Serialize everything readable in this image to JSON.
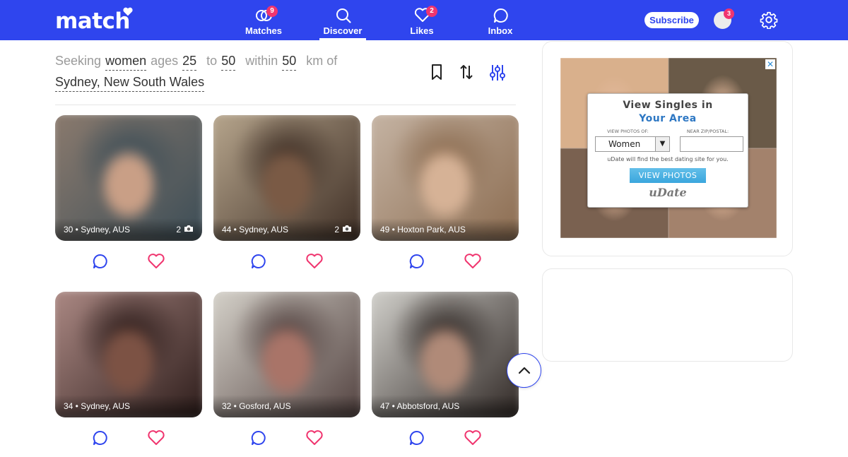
{
  "header": {
    "logo": "match",
    "nav": [
      {
        "label": "Matches",
        "badge": "9"
      },
      {
        "label": "Discover",
        "badge": ""
      },
      {
        "label": "Likes",
        "badge": "2"
      },
      {
        "label": "Inbox",
        "badge": ""
      }
    ],
    "active_nav": "Discover",
    "subscribe": "Subscribe",
    "avatar_badge": "3"
  },
  "filters": {
    "seeking": "Seeking",
    "gender": "women",
    "ages": "ages",
    "age_min": "25",
    "to": "to",
    "age_max": "50",
    "within": "within",
    "distance": "50",
    "unit": "km of",
    "location": "Sydney, New South Wales"
  },
  "profiles": [
    {
      "caption": "30 • Sydney, AUS",
      "photo_count": "2",
      "colors": [
        "#8c7b6e",
        "#3a4c56",
        "#c99f86"
      ]
    },
    {
      "caption": "44 • Sydney, AUS",
      "photo_count": "2",
      "colors": [
        "#b9a88f",
        "#3b2b22",
        "#7a5a45"
      ]
    },
    {
      "caption": "49 • Hoxton Park, AUS",
      "photo_count": "",
      "colors": [
        "#c6b5a5",
        "#8a6a4e",
        "#d6b296"
      ]
    },
    {
      "caption": "34 • Sydney, AUS",
      "photo_count": "",
      "colors": [
        "#ae8b86",
        "#2a1a18",
        "#7c5244"
      ]
    },
    {
      "caption": "32 • Gosford, AUS",
      "photo_count": "",
      "colors": [
        "#d8d5cd",
        "#4f3e3c",
        "#a97468"
      ]
    },
    {
      "caption": "47 • Abbotsford, AUS",
      "photo_count": "",
      "colors": [
        "#d5d4cf",
        "#2b2320",
        "#b08a78"
      ]
    }
  ],
  "ad": {
    "title_line1": "View Singles in",
    "title_line2": "Your Area",
    "label_photos": "VIEW PHOTOS OF:",
    "label_zip": "NEAR ZIP/POSTAL:",
    "select_value": "Women",
    "tagline": "uDate will find the best dating site for you.",
    "button": "VIEW PHOTOS",
    "brand": "uDate",
    "close": "✕",
    "tile_colors": [
      "#d9b08c",
      "#6a5a48",
      "#7a6150",
      "#a3826c"
    ]
  },
  "colors": {
    "brand": "#2f45ee",
    "accent": "#f0356f"
  }
}
